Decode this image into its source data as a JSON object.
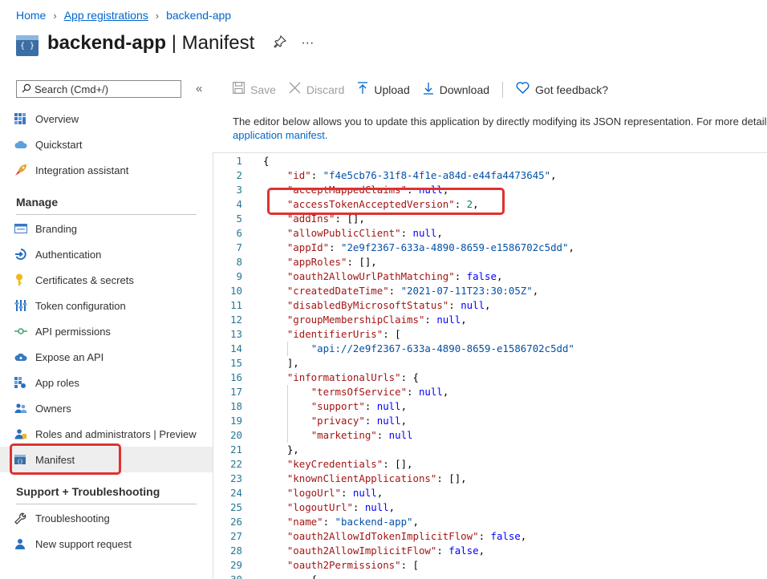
{
  "breadcrumb": {
    "home": "Home",
    "app_registrations": "App registrations",
    "current": "backend-app"
  },
  "header": {
    "icon_text": "{ }",
    "app_name": "backend-app",
    "separator": " | ",
    "page": "Manifest",
    "pin": "⚲",
    "more": "···"
  },
  "sidebar": {
    "search_placeholder": "Search (Cmd+/)",
    "collapse": "«",
    "top_items": [
      {
        "label": "Overview"
      },
      {
        "label": "Quickstart"
      },
      {
        "label": "Integration assistant"
      }
    ],
    "manage_header": "Manage",
    "manage_items": [
      {
        "label": "Branding"
      },
      {
        "label": "Authentication"
      },
      {
        "label": "Certificates & secrets"
      },
      {
        "label": "Token configuration"
      },
      {
        "label": "API permissions"
      },
      {
        "label": "Expose an API"
      },
      {
        "label": "App roles"
      },
      {
        "label": "Owners"
      },
      {
        "label": "Roles and administrators | Preview"
      },
      {
        "label": "Manifest"
      }
    ],
    "support_header": "Support + Troubleshooting",
    "support_items": [
      {
        "label": "Troubleshooting"
      },
      {
        "label": "New support request"
      }
    ]
  },
  "toolbar": {
    "save": "Save",
    "discard": "Discard",
    "upload": "Upload",
    "download": "Download",
    "feedback": "Got feedback?"
  },
  "description": {
    "text": "The editor below allows you to update this application by directly modifying its JSON representation. For more details, see:",
    "link": "application manifest."
  },
  "editor": {
    "lines": [
      {
        "n": "1",
        "t": "{"
      },
      {
        "n": "2",
        "t": "    \"id\": \"f4e5cb76-31f8-4f1e-a84d-e44fa4473645\","
      },
      {
        "n": "3",
        "t": "    \"acceptMappedClaims\": null,"
      },
      {
        "n": "4",
        "t": "    \"accessTokenAcceptedVersion\": 2,"
      },
      {
        "n": "5",
        "t": "    \"addIns\": [],"
      },
      {
        "n": "6",
        "t": "    \"allowPublicClient\": null,"
      },
      {
        "n": "7",
        "t": "    \"appId\": \"2e9f2367-633a-4890-8659-e1586702c5dd\","
      },
      {
        "n": "8",
        "t": "    \"appRoles\": [],"
      },
      {
        "n": "9",
        "t": "    \"oauth2AllowUrlPathMatching\": false,"
      },
      {
        "n": "10",
        "t": "    \"createdDateTime\": \"2021-07-11T23:30:05Z\","
      },
      {
        "n": "11",
        "t": "    \"disabledByMicrosoftStatus\": null,"
      },
      {
        "n": "12",
        "t": "    \"groupMembershipClaims\": null,"
      },
      {
        "n": "13",
        "t": "    \"identifierUris\": ["
      },
      {
        "n": "14",
        "t": "        \"api://2e9f2367-633a-4890-8659-e1586702c5dd\""
      },
      {
        "n": "15",
        "t": "    ],"
      },
      {
        "n": "16",
        "t": "    \"informationalUrls\": {"
      },
      {
        "n": "17",
        "t": "        \"termsOfService\": null,"
      },
      {
        "n": "18",
        "t": "        \"support\": null,"
      },
      {
        "n": "19",
        "t": "        \"privacy\": null,"
      },
      {
        "n": "20",
        "t": "        \"marketing\": null"
      },
      {
        "n": "21",
        "t": "    },"
      },
      {
        "n": "22",
        "t": "    \"keyCredentials\": [],"
      },
      {
        "n": "23",
        "t": "    \"knownClientApplications\": [],"
      },
      {
        "n": "24",
        "t": "    \"logoUrl\": null,"
      },
      {
        "n": "25",
        "t": "    \"logoutUrl\": null,"
      },
      {
        "n": "26",
        "t": "    \"name\": \"backend-app\","
      },
      {
        "n": "27",
        "t": "    \"oauth2AllowIdTokenImplicitFlow\": false,"
      },
      {
        "n": "28",
        "t": "    \"oauth2AllowImplicitFlow\": false,"
      },
      {
        "n": "29",
        "t": "    \"oauth2Permissions\": ["
      },
      {
        "n": "30",
        "t": "        {"
      }
    ]
  },
  "colors": {
    "accent": "#0066cc",
    "highlight": "#e0312f"
  }
}
